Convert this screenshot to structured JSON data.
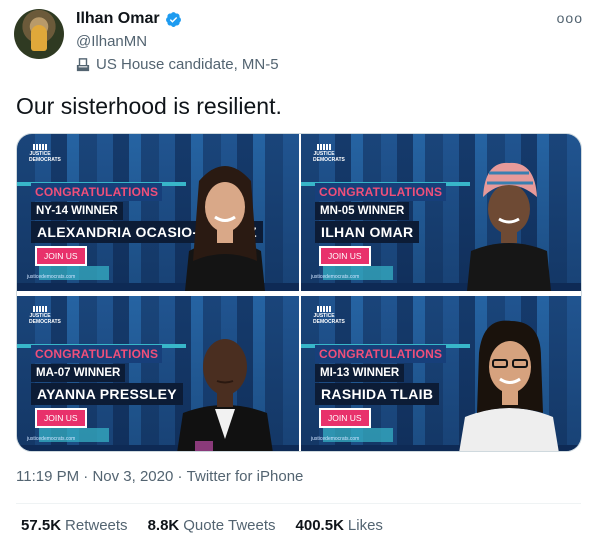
{
  "author": {
    "name": "Ilhan Omar",
    "handle": "@IlhanMN",
    "label": "US House candidate, MN-5",
    "icons": {
      "verified": "verified-badge-icon",
      "label": "ballot-box-icon",
      "more": "more-options-icon"
    }
  },
  "tweet": {
    "text": "Our sisterhood is resilient."
  },
  "media": {
    "cards": [
      {
        "org": "JUSTICE DEMOCRATS",
        "congrats": "CONGRATULATIONS",
        "winner": "NY-14 WINNER",
        "candidate": "ALEXANDRIA OCASIO-CORTEZ",
        "join": "JOIN US",
        "site": "justicedemocrats.com",
        "photo": "portrait-1"
      },
      {
        "org": "JUSTICE DEMOCRATS",
        "congrats": "CONGRATULATIONS",
        "winner": "MN-05 WINNER",
        "candidate": "ILHAN OMAR",
        "join": "JOIN US",
        "site": "justicedemocrats.com",
        "photo": "portrait-2"
      },
      {
        "org": "JUSTICE DEMOCRATS",
        "congrats": "CONGRATULATIONS",
        "winner": "MA-07 WINNER",
        "candidate": "AYANNA PRESSLEY",
        "join": "JOIN US",
        "site": "justicedemocrats.com",
        "photo": "portrait-3"
      },
      {
        "org": "JUSTICE DEMOCRATS",
        "congrats": "CONGRATULATIONS",
        "winner": "MI-13 WINNER",
        "candidate": "RASHIDA TLAIB",
        "join": "JOIN US",
        "site": "justicedemocrats.com",
        "photo": "portrait-4"
      }
    ]
  },
  "meta": {
    "time": "11:19 PM",
    "sep": "·",
    "date": "Nov 3, 2020",
    "source": "Twitter for iPhone"
  },
  "stats": {
    "retweets": {
      "count": "57.5K",
      "label": "Retweets"
    },
    "quotes": {
      "count": "8.8K",
      "label": "Quote Tweets"
    },
    "likes": {
      "count": "400.5K",
      "label": "Likes"
    }
  },
  "colors": {
    "verified": "#1d9bf0",
    "muted": "#536471",
    "text": "#0f1419",
    "card_blue": "#1d4f86",
    "pink": "#e8316b",
    "teal": "#38b6c9"
  }
}
